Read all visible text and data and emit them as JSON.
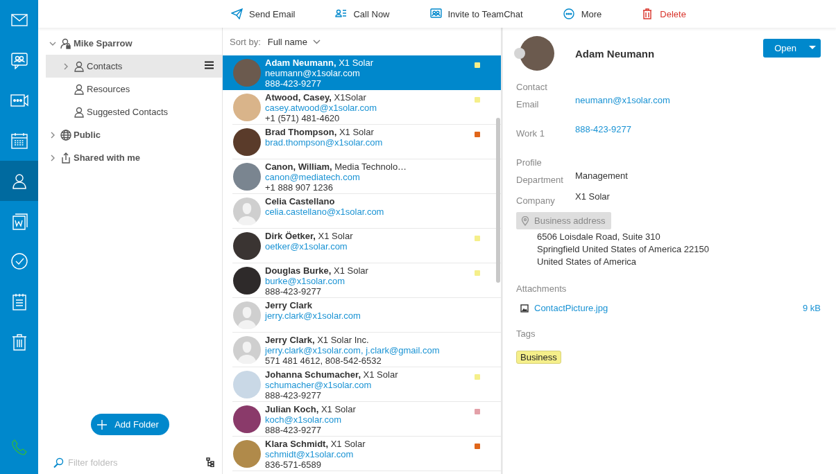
{
  "nav": [
    {
      "kind": "mail",
      "selected": false
    },
    {
      "kind": "chat",
      "selected": false
    },
    {
      "kind": "meeting",
      "selected": false
    },
    {
      "kind": "calendar",
      "selected": false
    },
    {
      "kind": "contacts",
      "selected": true
    },
    {
      "kind": "notes",
      "selected": false
    },
    {
      "kind": "tasks",
      "selected": false
    },
    {
      "kind": "journal",
      "selected": false
    },
    {
      "kind": "trash",
      "selected": false
    }
  ],
  "nav_bottom": [
    {
      "kind": "phone",
      "selected": false
    }
  ],
  "toolbar": [
    {
      "kind": "send",
      "label": "Send Email"
    },
    {
      "kind": "call",
      "label": "Call Now"
    },
    {
      "kind": "invite",
      "label": "Invite to TeamChat"
    },
    {
      "kind": "more",
      "label": "More"
    },
    {
      "kind": "delete",
      "label": "Delete"
    }
  ],
  "folders": {
    "tree": [
      {
        "label": "Mike Sparrow",
        "kind": "account",
        "expanded": true,
        "selected": false,
        "children": [
          {
            "label": "Contacts",
            "kind": "person",
            "expanded": false,
            "selected": true
          },
          {
            "label": "Resources",
            "kind": "person",
            "selected": false
          },
          {
            "label": "Suggested Contacts",
            "kind": "person",
            "selected": false
          }
        ]
      },
      {
        "label": "Public",
        "kind": "globe",
        "expanded": false,
        "selected": false
      },
      {
        "label": "Shared with me",
        "kind": "shared",
        "expanded": false,
        "selected": false
      }
    ],
    "add_folder": "Add Folder",
    "filter_placeholder": "Filter folders"
  },
  "contacts": {
    "sort_label": "Sort by:",
    "sort_value": "Full name",
    "list": [
      {
        "name": "Adam Neumann,",
        "company": "X1 Solar",
        "email": "neumann@x1solar.com",
        "phone": "888-423-9277",
        "kind": "photo",
        "color": "#f5ef8a",
        "selected": true
      },
      {
        "name": "Atwood, Casey,",
        "company": "X1Solar",
        "email": "casey.atwood@x1solar.com",
        "phone": "+1 (571) 481-4620",
        "kind": "photo",
        "color": "#f5ef8a",
        "selected": false
      },
      {
        "name": "Brad Thompson,",
        "company": "X1 Solar",
        "email": "brad.thompson@x1solar.com",
        "kind": "photo",
        "color": "#e0661a",
        "selected": false
      },
      {
        "name": "Canon, William,",
        "company": "Media Technolo…",
        "email": "canon@mediatech.com",
        "phone": "+1 888 907 1236",
        "kind": "photo",
        "selected": false
      },
      {
        "name": "Celia Castellano",
        "email": "celia.castellano@x1solar.com",
        "kind": "placeholder",
        "selected": false
      },
      {
        "name": "Dirk Öetker,",
        "company": "X1 Solar",
        "email": "oetker@x1solar.com",
        "kind": "photo",
        "color": "#f5ef8a",
        "selected": false
      },
      {
        "name": "Douglas Burke,",
        "company": "X1 Solar",
        "email": "burke@x1solar.com",
        "phone": "888-423-9277",
        "kind": "photo",
        "color": "#f5ef8a",
        "selected": false
      },
      {
        "name": "Jerry Clark",
        "email": "jerry.clark@x1solar.com",
        "kind": "placeholder",
        "selected": false
      },
      {
        "name": "Jerry Clark,",
        "company": "X1 Solar Inc.",
        "email": "jerry.clark@x1solar.com, j.clark@gmail.com",
        "phone": "571 481 4612, 808-542-6532",
        "kind": "placeholder",
        "selected": false
      },
      {
        "name": "Johanna Schumacher,",
        "company": "X1 Solar",
        "email": "schumacher@x1solar.com",
        "phone": "888-423-9277",
        "kind": "photo",
        "color": "#f5ef8a",
        "selected": false
      },
      {
        "name": "Julian Koch,",
        "company": "X1 Solar",
        "email": "koch@x1solar.com",
        "phone": "888-423-9277",
        "kind": "photo",
        "color": "#e3a0a8",
        "selected": false
      },
      {
        "name": "Klara Schmidt,",
        "company": "X1 Solar",
        "email": "schmidt@x1solar.com",
        "phone": "836-571-6589",
        "kind": "photo",
        "color": "#e0661a",
        "selected": false
      }
    ]
  },
  "detail": {
    "name": "Adam Neumann",
    "open_button": "Open",
    "sections": [
      {
        "title": "Contact",
        "fields": [
          {
            "label": "Email",
            "value": "neumann@x1solar.com",
            "kind": "link"
          },
          {
            "label": "Work 1",
            "value": "888-423-9277",
            "kind": "link"
          }
        ]
      },
      {
        "title": "Profile",
        "fields": [
          {
            "label": "Department",
            "value": "Management",
            "kind": "text"
          },
          {
            "label": "Company",
            "value": "X1 Solar",
            "kind": "text"
          }
        ]
      }
    ],
    "address": {
      "label": "Business address",
      "lines": [
        "6506 Loisdale Road, Suite 310",
        "Springfield United States of America 22150",
        "United States of America"
      ]
    },
    "attachments_title": "Attachments",
    "attachments": [
      {
        "name": "ContactPicture.jpg",
        "size": "9 kB"
      }
    ],
    "tags_title": "Tags",
    "tags": [
      {
        "label": "Business",
        "color": "#f5ef8a"
      }
    ]
  }
}
